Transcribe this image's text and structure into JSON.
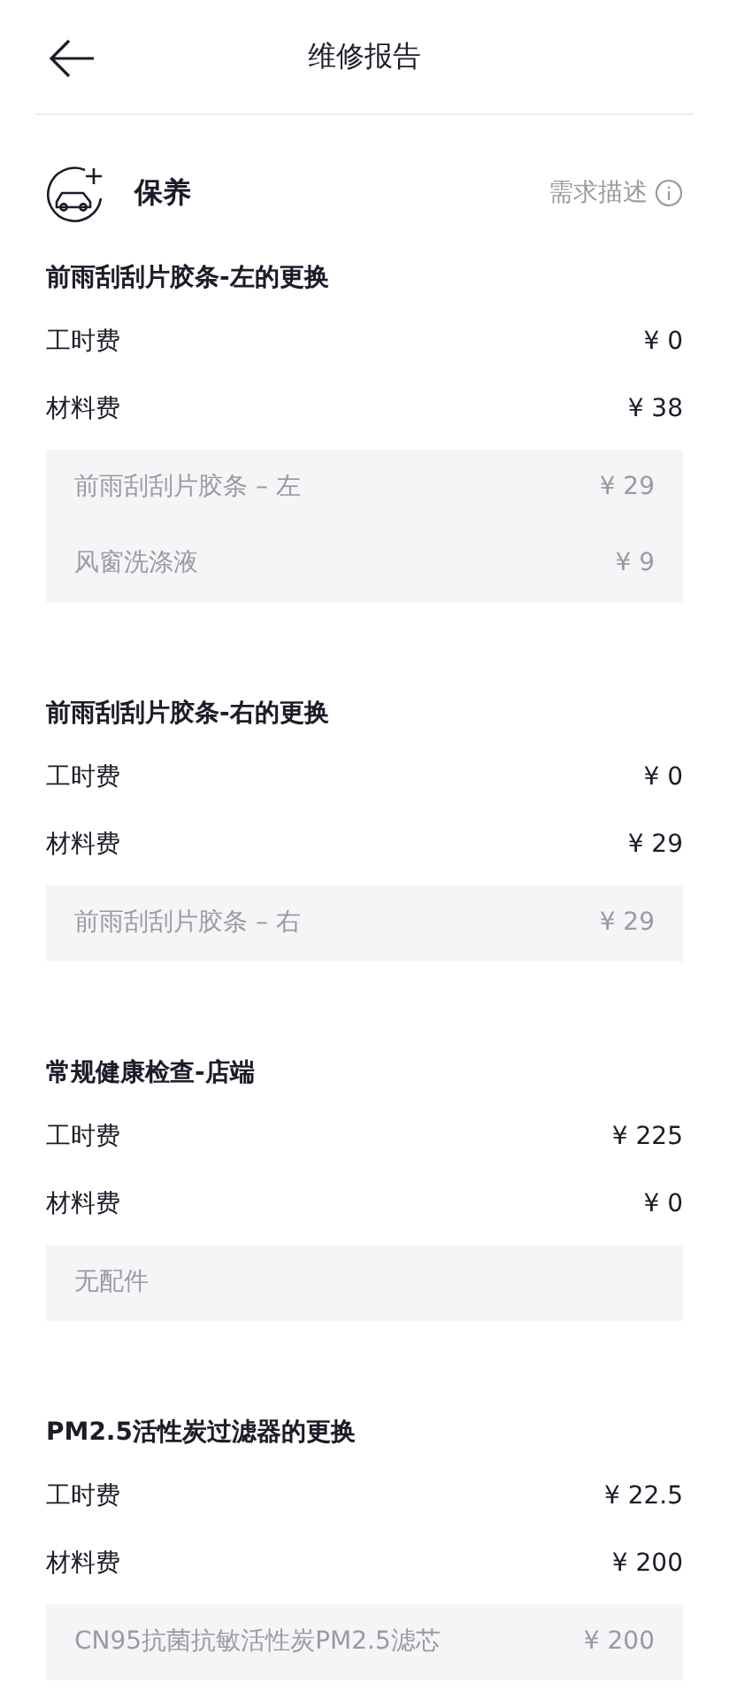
{
  "header": {
    "title": "维修报告"
  },
  "section": {
    "title": "保养",
    "action": "需求描述"
  },
  "items": [
    {
      "title": "前雨刮刮片胶条-左的更换",
      "fees": [
        {
          "label": "工时费",
          "value": "¥ 0"
        },
        {
          "label": "材料费",
          "value": "¥ 38"
        }
      ],
      "parts": [
        {
          "kind": "part",
          "name": "前雨刮刮片胶条 – 左",
          "price": "¥ 29"
        },
        {
          "kind": "part",
          "name": "风窗洗涤液",
          "price": "¥ 9"
        }
      ]
    },
    {
      "title": "前雨刮刮片胶条-右的更换",
      "fees": [
        {
          "label": "工时费",
          "value": "¥ 0"
        },
        {
          "label": "材料费",
          "value": "¥ 29"
        }
      ],
      "parts": [
        {
          "kind": "part",
          "name": "前雨刮刮片胶条 – 右",
          "price": "¥ 29"
        }
      ]
    },
    {
      "title": "常规健康检查-店端",
      "fees": [
        {
          "label": "工时费",
          "value": "¥ 225"
        },
        {
          "label": "材料费",
          "value": "¥ 0"
        }
      ],
      "parts": [
        {
          "kind": "note",
          "name": "无配件"
        }
      ]
    },
    {
      "title": "PM2.5活性炭过滤器的更换",
      "fees": [
        {
          "label": "工时费",
          "value": "¥ 22.5"
        },
        {
          "label": "材料费",
          "value": "¥ 200"
        }
      ],
      "parts": [
        {
          "kind": "part",
          "name": "CN95抗菌抗敏活性炭PM2.5滤芯",
          "price": "¥ 200"
        }
      ]
    }
  ]
}
